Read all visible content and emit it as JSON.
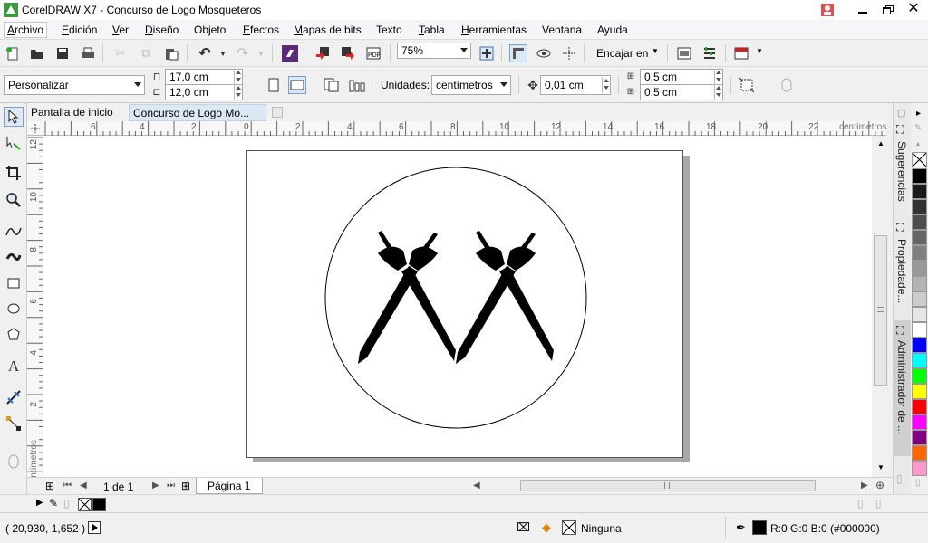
{
  "window": {
    "title": "CorelDRAW X7 - Concurso de Logo Mosqueteros"
  },
  "menu": [
    {
      "label": "Archivo",
      "active": true
    },
    {
      "label": "Edición"
    },
    {
      "label": "Ver"
    },
    {
      "label": "Diseño"
    },
    {
      "label": "Objeto"
    },
    {
      "label": "Efectos"
    },
    {
      "label": "Mapas de bits"
    },
    {
      "label": "Texto"
    },
    {
      "label": "Tabla"
    },
    {
      "label": "Herramientas"
    },
    {
      "label": "Ventana"
    },
    {
      "label": "Ayuda"
    }
  ],
  "toolbar": {
    "zoom_value": "75%",
    "snap_label": "Encajar en"
  },
  "propbar": {
    "preset": "Personalizar",
    "width": "17,0 cm",
    "height": "12,0 cm",
    "units_label": "Unidades:",
    "units_value": "centímetros",
    "nudge": "0,01 cm",
    "dup_x": "0,5 cm",
    "dup_y": "0,5 cm"
  },
  "tabs": {
    "home": "Pantalla de inicio",
    "document": "Concurso de Logo Mo..."
  },
  "rulers": {
    "h_ticks": [
      "6",
      "4",
      "2",
      "0",
      "2",
      "4",
      "6",
      "8",
      "10",
      "12",
      "14",
      "16",
      "18",
      "20",
      "22"
    ],
    "h_unit": "centímetros",
    "v_ticks": [
      "12",
      "10",
      "8",
      "6",
      "4",
      "2"
    ],
    "v_unit": "centímetros"
  },
  "pager": {
    "page_count": "1 de 1",
    "page_tab": "Página 1"
  },
  "dockers": {
    "hints": "Sugerencias",
    "properties": "Propiedade...",
    "object_manager": "Administrador de ..."
  },
  "palette": {
    "colors": [
      "#000000",
      "#1a1a1a",
      "#333333",
      "#4d4d4d",
      "#666666",
      "#808080",
      "#999999",
      "#b3b3b3",
      "#cccccc",
      "#e6e6e6",
      "#ffffff",
      "#0000ff",
      "#00ffff",
      "#00ff00",
      "#ffff00",
      "#ff0000",
      "#ff00ff",
      "#800080",
      "#ff6600",
      "#ff99cc"
    ]
  },
  "status": {
    "coords": "( 20,930, 1,652  )",
    "fill_label": "Ninguna",
    "outline_color": "R:0 G:0 B:0 (#000000)"
  }
}
